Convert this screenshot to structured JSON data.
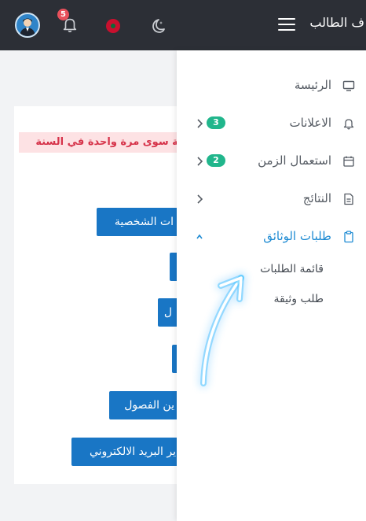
{
  "topbar": {
    "brand_text": "ف الطالب",
    "notification_count": "5"
  },
  "content": {
    "alert_text": "وية سوى مرة واحدة في السنة",
    "buttons": [
      {
        "label": "ات الشخصية"
      },
      {
        "label": ""
      },
      {
        "label": "ل"
      },
      {
        "label": ""
      },
      {
        "label": "ين الفصول"
      },
      {
        "label": "ير البريد الالكتروني"
      }
    ]
  },
  "sidebar": {
    "items": [
      {
        "label": "الرئيسة",
        "icon": "monitor-icon"
      },
      {
        "label": "الاعلانات",
        "icon": "bell-icon",
        "count": "3"
      },
      {
        "label": "استعمال الزمن",
        "icon": "calendar-icon",
        "count": "2"
      },
      {
        "label": "النتائج",
        "icon": "file-icon"
      },
      {
        "label": "طلبات الوثائق",
        "icon": "clipboard-icon"
      }
    ],
    "subitems": [
      {
        "label": "قائمة الطلبات"
      },
      {
        "label": "طلب وثيقة"
      }
    ]
  },
  "colors": {
    "topbar": "#2c2f36",
    "accent": "#1e8bd3",
    "button": "#1976c5",
    "badge_green": "#21b68c",
    "badge_red": "#e8505b",
    "alert_bg": "#fde2e4",
    "alert_text": "#d6334a"
  }
}
